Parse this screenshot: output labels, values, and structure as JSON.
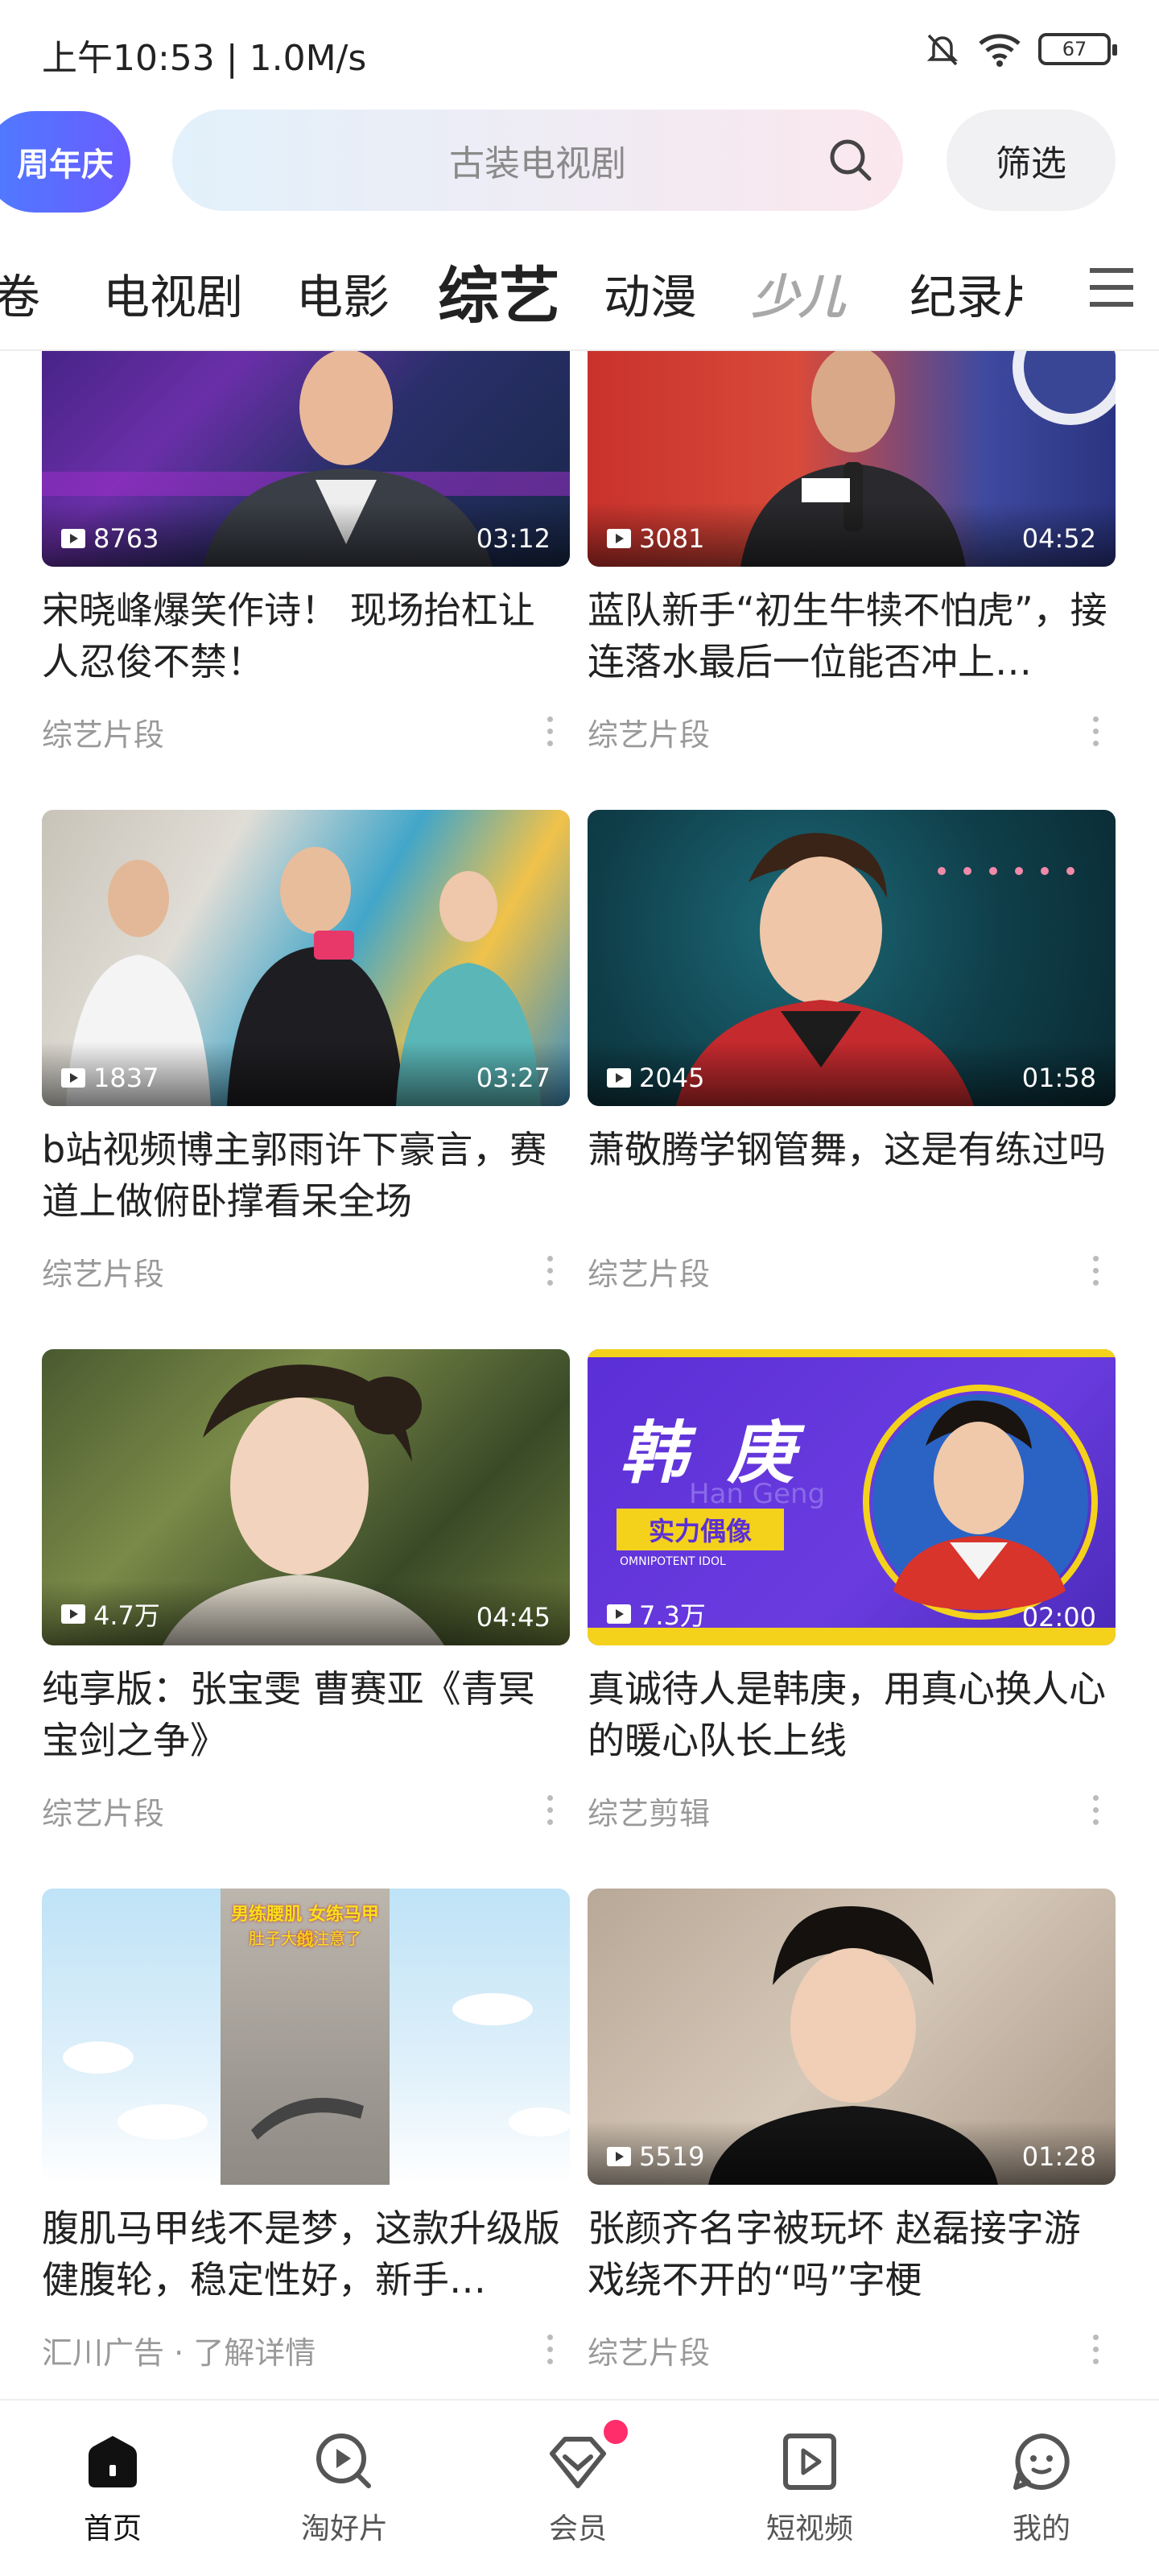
{
  "status_bar": {
    "time": "上午10:53 | 1.0M/s",
    "battery": "67"
  },
  "header": {
    "anniversary_badge": "周年庆",
    "search_placeholder": "古装电视剧",
    "filter_label": "筛选"
  },
  "categories": {
    "items": [
      "卷",
      "电视剧",
      "电影",
      "综艺",
      "动漫",
      "少儿",
      "纪录片"
    ],
    "active": "综艺"
  },
  "feed": {
    "cards": [
      {
        "title": "宋晓峰爆笑作诗！ 现场抬杠让人忍俊不禁！",
        "views": "8763",
        "duration": "03:12",
        "meta": "综艺片段"
      },
      {
        "title": "蓝队新手“初生牛犊不怕虎”，接连落水最后一位能否冲上…",
        "views": "3081",
        "duration": "04:52",
        "meta": "综艺片段"
      },
      {
        "title": "b站视频博主郭雨许下豪言，赛道上做俯卧撑看呆全场",
        "views": "1837",
        "duration": "03:27",
        "meta": "综艺片段"
      },
      {
        "title": "萧敬腾学钢管舞，这是有练过吗",
        "views": "2045",
        "duration": "01:58",
        "meta": "综艺片段"
      },
      {
        "title": "纯享版：张宝雯 曹赛亚《青冥宝剑之争》",
        "views": "4.7万",
        "duration": "04:45",
        "meta": "综艺片段"
      },
      {
        "title": "真诚待人是韩庚，用真心换人心的暖心队长上线",
        "views": "7.3万",
        "duration": "02:00",
        "meta": "综艺剪辑"
      },
      {
        "title": "腹肌马甲线不是梦，这款升级版健腹轮，稳定性好，新手…",
        "views": "",
        "duration": "",
        "meta": "汇川广告 · 了解详情"
      },
      {
        "title": "张颜齐名字被玩坏 赵磊接字游戏绕不开的“吗”字梗",
        "views": "5519",
        "duration": "01:28",
        "meta": "综艺片段"
      }
    ]
  },
  "thumb_text": {
    "han_geng_name": "韩 庚",
    "han_geng_pinyin": "Han Geng",
    "han_geng_tag": "实力偶像",
    "han_geng_tag_sub": "OMNIPOTENT IDOL",
    "ad_caption_1": "男练腰肌 女练马甲线",
    "ad_caption_2": "肚子大的注意了"
  },
  "bottom_nav": {
    "items": [
      "首页",
      "淘好片",
      "会员",
      "短视频",
      "我的"
    ],
    "active": "首页"
  }
}
